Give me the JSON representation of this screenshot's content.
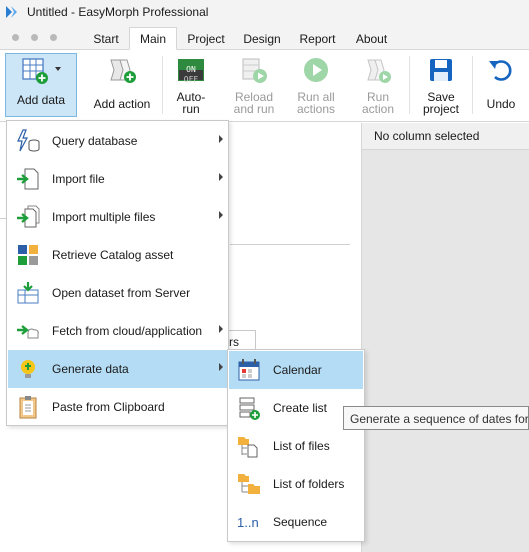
{
  "window": {
    "title": "Untitled - EasyMorph Professional"
  },
  "tabs": [
    {
      "label": "Start"
    },
    {
      "label": "Main"
    },
    {
      "label": "Project"
    },
    {
      "label": "Design"
    },
    {
      "label": "Report"
    },
    {
      "label": "About"
    }
  ],
  "ribbon": {
    "add_data": "Add data",
    "add_action": "Add action",
    "auto_run": "Auto-\nrun",
    "auto_run_badge_on": "ON",
    "auto_run_badge_off": "OFF",
    "reload_and_run": "Reload\nand run",
    "run_all_actions": "Run all\nactions",
    "run_action": "Run\naction",
    "save_project": "Save\nproject",
    "undo": "Undo"
  },
  "right_panel": {
    "header": "No column selected"
  },
  "background": {
    "partial_text": "rs"
  },
  "add_data_menu": {
    "items": [
      {
        "label": "Query database",
        "has_submenu": true,
        "icon": "lightning-database-icon"
      },
      {
        "label": "Import file",
        "has_submenu": true,
        "icon": "import-file-icon"
      },
      {
        "label": "Import multiple files",
        "has_submenu": true,
        "icon": "import-multiple-files-icon"
      },
      {
        "label": "Retrieve Catalog asset",
        "has_submenu": false,
        "icon": "catalog-icon"
      },
      {
        "label": "Open dataset from Server",
        "has_submenu": false,
        "icon": "server-dataset-icon"
      },
      {
        "label": "Fetch from cloud/application",
        "has_submenu": true,
        "icon": "cloud-fetch-icon"
      },
      {
        "label": "Generate data",
        "has_submenu": true,
        "icon": "lightbulb-icon"
      },
      {
        "label": "Paste from Clipboard",
        "has_submenu": false,
        "icon": "clipboard-icon"
      }
    ]
  },
  "generate_data_submenu": {
    "items": [
      {
        "label": "Calendar",
        "icon": "calendar-icon"
      },
      {
        "label": "Create list",
        "icon": "create-list-icon"
      },
      {
        "label": "List of files",
        "icon": "list-of-files-icon"
      },
      {
        "label": "List of folders",
        "icon": "list-of-folders-icon"
      },
      {
        "label": "Sequence",
        "icon": "sequence-icon",
        "glyph": "1..n"
      }
    ]
  },
  "tooltip": {
    "text": "Generate a sequence of dates for s"
  },
  "colors": {
    "highlight": "#b5dcf5",
    "pressed": "#cde6f7",
    "accent_green": "#1e9e3a",
    "accent_blue": "#1565c0"
  }
}
